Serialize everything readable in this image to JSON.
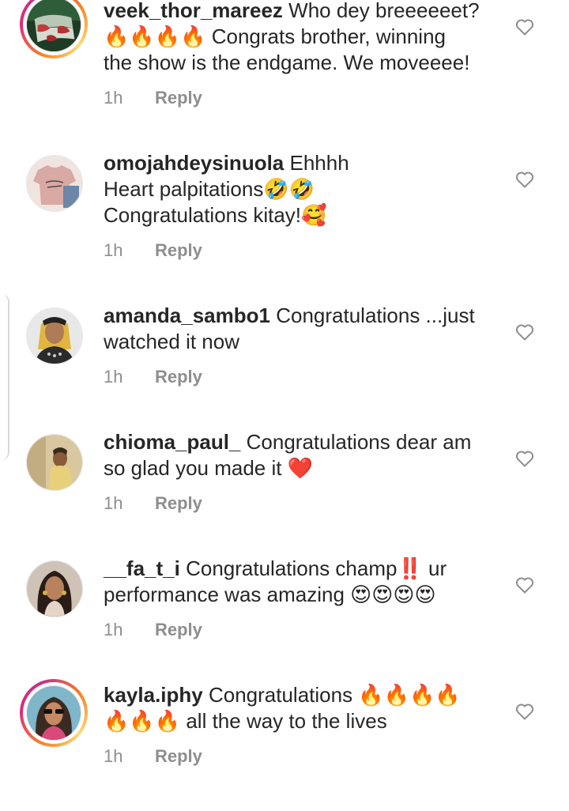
{
  "comments": [
    {
      "username": "veek_thor_mareez",
      "text_lines": [
        "Who dey breeeeeet?",
        "🔥🔥🔥🔥 Congrats brother, winning",
        "the show is the endgame. We moveeee!"
      ],
      "time": "1h",
      "reply": "Reply",
      "avatar": "green-flag-avatar",
      "has_story": true
    },
    {
      "username": "omojahdeysinuola",
      "text_lines": [
        "Ehhhh",
        "Heart palpitations🤣🤣",
        "Congratulations kitay!🥰"
      ],
      "time": "1h",
      "reply": "Reply",
      "avatar": "tshirt-avatar",
      "has_story": false
    },
    {
      "username": "amanda_sambo1",
      "text_lines": [
        "Congratulations ...just",
        "watched it now"
      ],
      "time": "1h",
      "reply": "Reply",
      "avatar": "blonde-woman-avatar",
      "has_story": false
    },
    {
      "username": "chioma_paul_",
      "text_lines": [
        "Congratulations dear am",
        "so glad you made it ❤️"
      ],
      "time": "1h",
      "reply": "Reply",
      "avatar": "woman-beige-avatar",
      "has_story": false
    },
    {
      "username": "__fa_t_i",
      "text_lines": [
        "Congratulations champ‼️ ur",
        "performance was amazing 😍😍😍😍"
      ],
      "time": "1h",
      "reply": "Reply",
      "avatar": "woman-portrait-avatar",
      "has_story": false
    },
    {
      "username": "kayla.iphy",
      "text_lines": [
        "Congratulations 🔥🔥🔥🔥",
        "🔥🔥🔥 all the way to the lives"
      ],
      "time": "1h",
      "reply": "Reply",
      "avatar": "woman-sunglasses-avatar",
      "has_story": true
    }
  ],
  "colors": {
    "text": "#262626",
    "muted": "#8e8e8e",
    "story_ring_start": "#f58529",
    "story_ring_end": "#dd2a7b"
  },
  "icons": {
    "like": "heart-outline-icon"
  }
}
